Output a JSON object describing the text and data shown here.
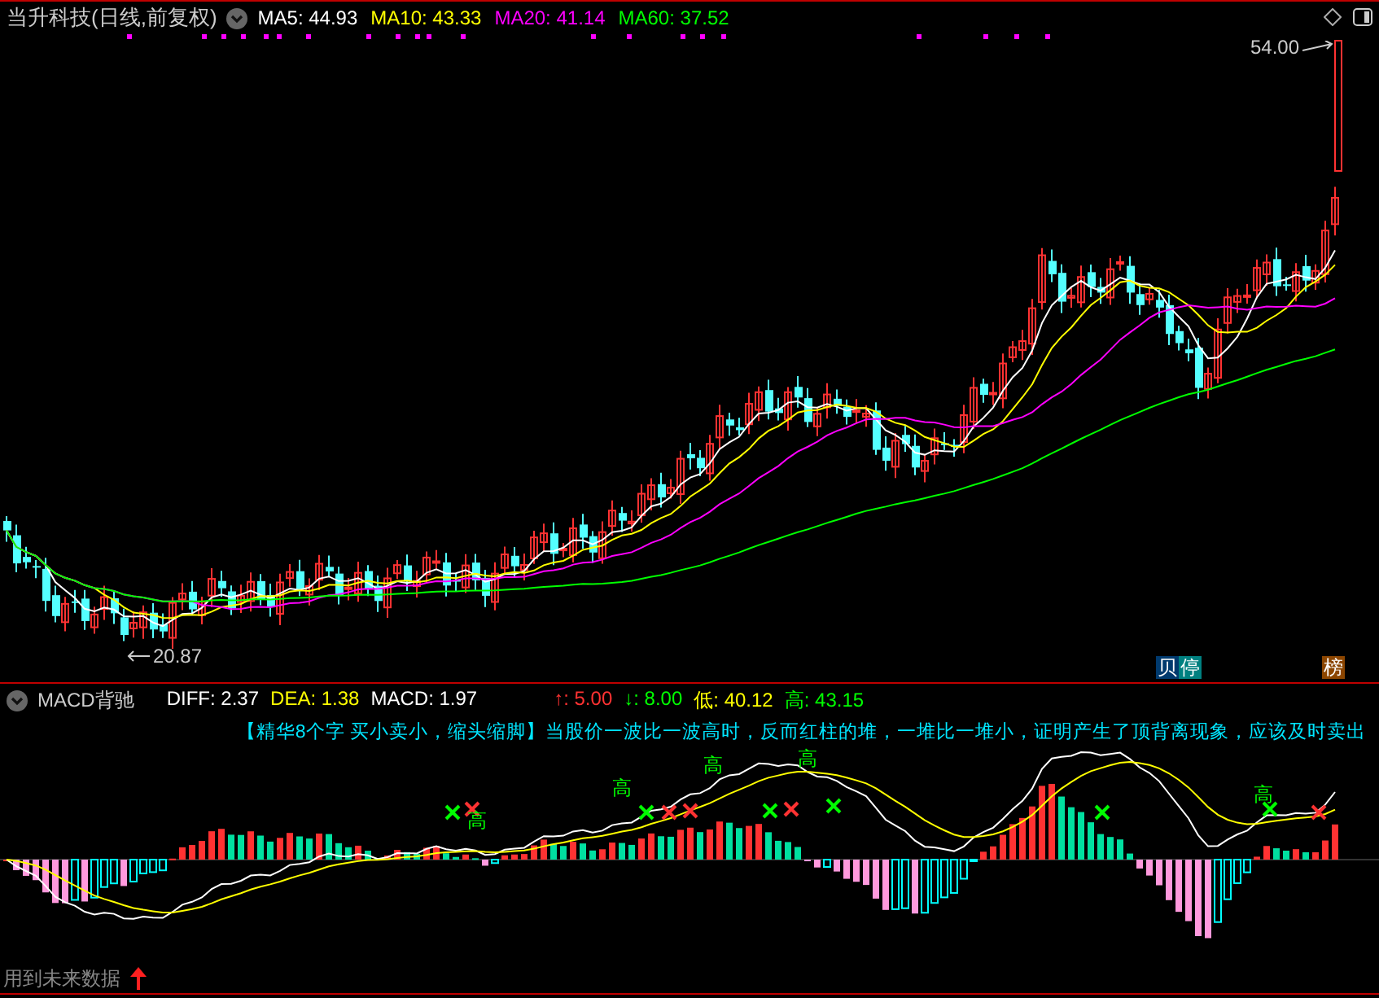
{
  "main": {
    "title": "当升科技(日线,前复权)",
    "indicators": [
      {
        "label": "MA5: 44.93",
        "color": "#ffffff"
      },
      {
        "label": "MA10: 43.33",
        "color": "#ffff00"
      },
      {
        "label": "MA20: 41.14",
        "color": "#ff00ff"
      },
      {
        "label": "MA60: 37.52",
        "color": "#00ff00"
      }
    ],
    "high_marker": "54.00",
    "low_marker": "20.87",
    "badges": [
      {
        "text": "贝",
        "color": "#003a6e"
      },
      {
        "text": "停",
        "color": "#008080"
      },
      {
        "text": "榜",
        "color": "#8b4500"
      }
    ]
  },
  "macd": {
    "title": "MACD背驰",
    "values": [
      {
        "label": "DIFF: 2.37",
        "color": "#ffffff"
      },
      {
        "label": "DEA: 1.38",
        "color": "#ffff00"
      },
      {
        "label": "MACD: 1.97",
        "color": "#ffffff"
      },
      {
        "label": "↑: 5.00",
        "color": "#ff3232"
      },
      {
        "label": "↓: 8.00",
        "color": "#00ff00"
      },
      {
        "label": "低: 40.12",
        "color": "#ffff00"
      },
      {
        "label": "高: 43.15",
        "color": "#00ff00"
      }
    ],
    "description": "【精华8个字 买小卖小，缩头缩脚】当股价一波比一波高时，反而红柱的堆，一堆比一堆小，证明产生了顶背离现象，应该及时卖出",
    "peak_labels": [
      "高",
      "高",
      "高",
      "高",
      "高"
    ],
    "footnote": "用到未来数据"
  }
}
